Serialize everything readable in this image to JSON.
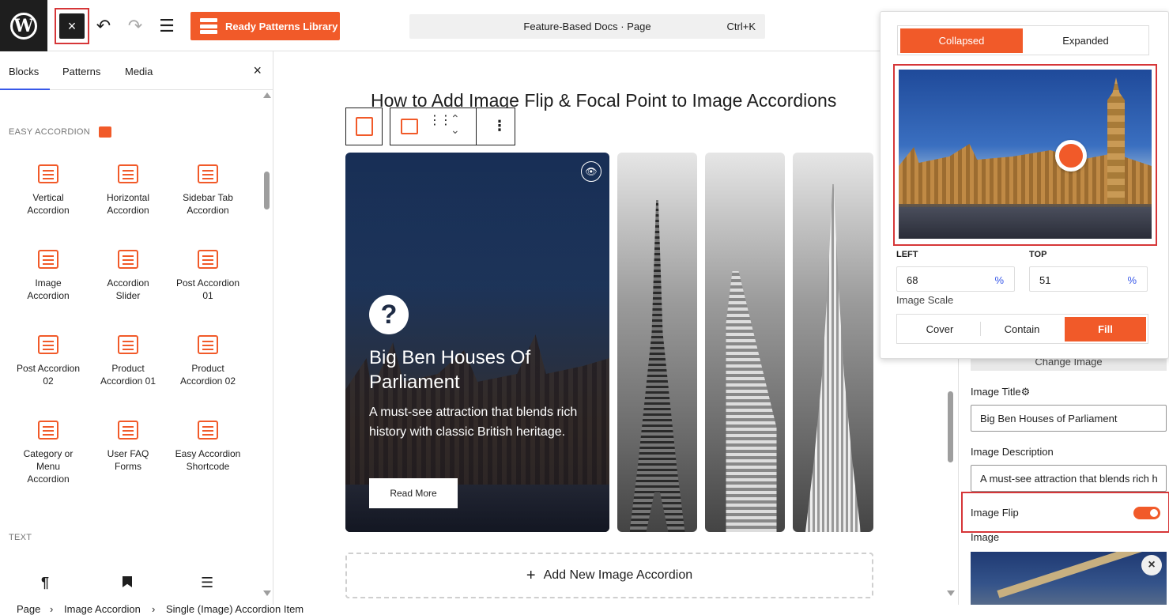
{
  "topbar": {
    "logo_letter": "W",
    "close_icon": "×",
    "undo_icon": "↶",
    "redo_icon": "↷",
    "list_view_icon": "☰",
    "ready_patterns_label": "Ready Patterns Library",
    "doc_title": "Feature-Based Docs · Page",
    "shortcut": "Ctrl+K"
  },
  "left_panel": {
    "tabs": [
      "Blocks",
      "Patterns",
      "Media"
    ],
    "close_icon": "×",
    "category_easy": "EASY ACCORDION",
    "category_text": "TEXT",
    "blocks": [
      {
        "label": "Vertical\nAccordion",
        "icon": "vertical-accordion-icon"
      },
      {
        "label": "Horizontal\nAccordion",
        "icon": "horizontal-accordion-icon"
      },
      {
        "label": "Sidebar Tab\nAccordion",
        "icon": "sidebar-tab-accordion-icon"
      },
      {
        "label": "Image\nAccordion",
        "icon": "image-accordion-icon"
      },
      {
        "label": "Accordion\nSlider",
        "icon": "accordion-slider-icon"
      },
      {
        "label": "Post Accordion\n01",
        "icon": "post-accordion-icon"
      },
      {
        "label": "Post Accordion\n02",
        "icon": "post-accordion-2-icon"
      },
      {
        "label": "Product\nAccordion 01",
        "icon": "product-accordion-icon"
      },
      {
        "label": "Product\nAccordion 02",
        "icon": "product-accordion-2-icon"
      },
      {
        "label": "Category or\nMenu\nAccordion",
        "icon": "category-accordion-icon"
      },
      {
        "label": "User FAQ\nForms",
        "icon": "faq-forms-icon"
      },
      {
        "label": "Easy Accordion\nShortcode",
        "icon": "shortcode-icon"
      }
    ],
    "text_blocks_icons": [
      "¶",
      "🔖",
      "☰"
    ]
  },
  "canvas": {
    "title": "How to Add Image Flip & Focal Point to Image Accordions",
    "main_card": {
      "title": "Big Ben Houses Of Parliament",
      "description": "A must-see attraction that blends rich history with classic British heritage.",
      "button": "Read More",
      "eye_icon": "👁",
      "question_icon": "?"
    },
    "add_new_label": "Add New Image Accordion",
    "add_icon": "+"
  },
  "popover": {
    "mode_options": [
      "Collapsed",
      "Expanded"
    ],
    "mode_selected": "Collapsed",
    "focal_left_label": "LEFT",
    "focal_left_value": "68",
    "focal_top_label": "TOP",
    "focal_top_value": "51",
    "unit": "%",
    "scale_label": "Image Scale",
    "scale_options": [
      "Cover",
      "Contain",
      "Fill"
    ],
    "scale_selected": "Fill",
    "accent": "#f15a29"
  },
  "right_panel": {
    "change_image": "Change Image",
    "image_title_label": "Image Title",
    "image_title_value": "Big Ben Houses of Parliament",
    "image_desc_label": "Image Description",
    "image_desc_value": "A must-see attraction that blends rich h",
    "image_flip_label": "Image Flip",
    "image_flip_on": true,
    "image_label": "Image",
    "remove_icon": "×",
    "gear_icon": "⚙"
  },
  "statusbar": {
    "crumbs": [
      "Page",
      "Image Accordion",
      "Single (Image) Accordion Item"
    ],
    "separator": "›"
  }
}
